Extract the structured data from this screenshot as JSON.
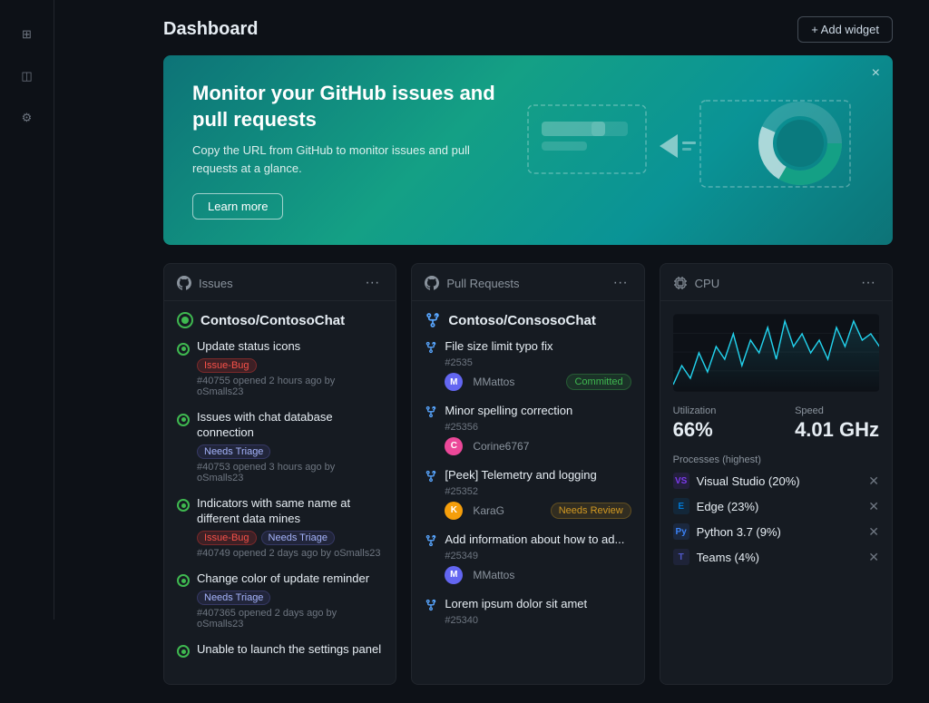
{
  "sidebar": {
    "icons": [
      "⊞",
      "◫",
      "⚙",
      "◻"
    ]
  },
  "header": {
    "title": "Dashboard",
    "add_widget_label": "+ Add widget"
  },
  "banner": {
    "title": "Monitor your GitHub issues and pull requests",
    "description": "Copy the URL from GitHub to monitor issues and pull requests at a glance.",
    "learn_more": "Learn more",
    "close": "×"
  },
  "issues_widget": {
    "label": "Issues",
    "repo": "Contoso/ContosoChat",
    "items": [
      {
        "title": "Update status icons",
        "tags": [
          "Issue-Bug"
        ],
        "meta": "#40755 opened 2 hours ago by oSmalls23"
      },
      {
        "title": "Issues with chat database connection",
        "tags": [
          "Needs Triage"
        ],
        "meta": "#40753 opened 3 hours ago by oSmalls23"
      },
      {
        "title": "Indicators with same name at different data mines",
        "tags": [
          "Issue-Bug",
          "Needs Triage"
        ],
        "meta": "#40749 opened 2 days ago by oSmalls23"
      },
      {
        "title": "Change color of update reminder",
        "tags": [
          "Needs Triage"
        ],
        "meta": "#407365 opened 2 days ago by oSmalls23"
      },
      {
        "title": "Unable to launch the settings panel",
        "tags": [],
        "meta": ""
      }
    ]
  },
  "pr_widget": {
    "label": "Pull Requests",
    "repo": "Contoso/ConsosoChat",
    "items": [
      {
        "title": "File size limit typo fix",
        "number": "#2535",
        "author": "MMattos",
        "avatar_color": "#6366f1",
        "badge": "Committed",
        "badge_type": "committed"
      },
      {
        "title": "Minor spelling correction",
        "number": "#25356",
        "author": "Corine6767",
        "avatar_color": "#ec4899",
        "badge": "",
        "badge_type": ""
      },
      {
        "title": "[Peek] Telemetry and logging",
        "number": "#25352",
        "author": "KaraG",
        "avatar_color": "#f59e0b",
        "badge": "Needs Review",
        "badge_type": "needs-review"
      },
      {
        "title": "Add information about how to ad...",
        "number": "#25349",
        "author": "MMattos",
        "avatar_color": "#6366f1",
        "badge": "",
        "badge_type": ""
      },
      {
        "title": "Lorem ipsum dolor sit amet",
        "number": "#25340",
        "author": "",
        "avatar_color": "",
        "badge": "",
        "badge_type": ""
      }
    ]
  },
  "cpu_widget": {
    "label": "CPU",
    "utilization_label": "Utilization",
    "speed_label": "Speed",
    "utilization_value": "66%",
    "speed_value": "4.01 GHz",
    "processes_label": "Processes (highest)",
    "processes": [
      {
        "name": "Visual Studio (20%)",
        "icon": "VS",
        "icon_color": "#7c3aed"
      },
      {
        "name": "Edge (23%)",
        "icon": "E",
        "icon_color": "#0078d4"
      },
      {
        "name": "Python 3.7 (9%)",
        "icon": "Py",
        "icon_color": "#3b82f6"
      },
      {
        "name": "Teams (4%)",
        "icon": "T",
        "icon_color": "#5059c9"
      }
    ],
    "chart_points": [
      30,
      45,
      35,
      55,
      40,
      60,
      50,
      70,
      45,
      65,
      55,
      75,
      50,
      80,
      60,
      70,
      55,
      65,
      50,
      75,
      60,
      80,
      65,
      70,
      60
    ]
  }
}
